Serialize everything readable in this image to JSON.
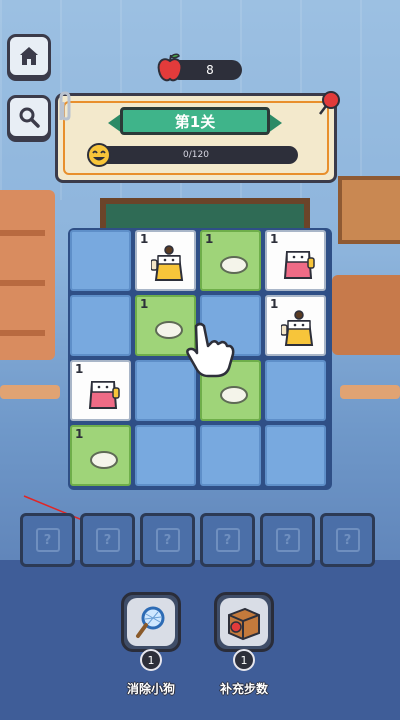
{
  "hud": {
    "apple_count": "8",
    "level_title": "第1关",
    "progress_text": "0/120",
    "progress_value": 0,
    "progress_max": 120
  },
  "side_buttons": [
    {
      "icon": "home-icon"
    },
    {
      "icon": "search-icon"
    }
  ],
  "board": {
    "rows": 4,
    "cols": 4,
    "cells": [
      {
        "kind": "empty"
      },
      {
        "kind": "chick",
        "count": "1"
      },
      {
        "kind": "rice",
        "count": "1"
      },
      {
        "kind": "box-girl",
        "count": "1"
      },
      {
        "kind": "empty"
      },
      {
        "kind": "rice",
        "count": "1"
      },
      {
        "kind": "empty"
      },
      {
        "kind": "chick",
        "count": "1"
      },
      {
        "kind": "box-girl",
        "count": "1"
      },
      {
        "kind": "empty"
      },
      {
        "kind": "rice",
        "count": "1"
      },
      {
        "kind": "empty"
      },
      {
        "kind": "rice",
        "count": "1"
      },
      {
        "kind": "empty"
      },
      {
        "kind": "empty"
      },
      {
        "kind": "empty"
      }
    ]
  },
  "slots": [
    {
      "icon": "locked-slot-icon"
    },
    {
      "icon": "locked-slot-icon"
    },
    {
      "icon": "locked-slot-icon"
    },
    {
      "icon": "locked-slot-icon"
    },
    {
      "icon": "locked-slot-icon"
    },
    {
      "icon": "locked-slot-icon"
    }
  ],
  "powerups": [
    {
      "label": "消除小狗",
      "count": "1",
      "icon": "net-icon"
    },
    {
      "label": "补充步数",
      "count": "1",
      "icon": "apple-crate-icon"
    }
  ],
  "colors": {
    "accent_green": "#3fb48a",
    "panel_border": "#e88f2c",
    "cell_green": "#9fd479",
    "cell_blue": "#78a9df"
  }
}
